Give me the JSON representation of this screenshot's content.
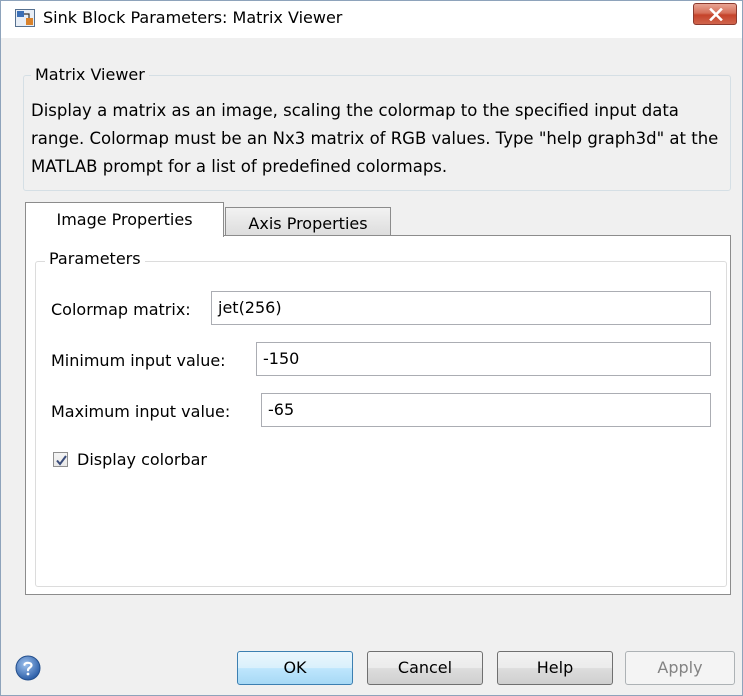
{
  "window": {
    "title": "Sink Block Parameters: Matrix Viewer"
  },
  "header_group": {
    "legend": "Matrix Viewer",
    "description": "Display a matrix as an image, scaling the colormap to the specified input data range.  Colormap must be an Nx3 matrix of RGB values.  Type \"help graph3d\" at the MATLAB prompt for a list of predefined colormaps."
  },
  "tabs": [
    {
      "label": "Image Properties",
      "active": true
    },
    {
      "label": "Axis Properties",
      "active": false
    }
  ],
  "parameters": {
    "legend": "Parameters",
    "colormap": {
      "label": "Colormap matrix:",
      "value": "jet(256)"
    },
    "min_input": {
      "label": "Minimum input value:",
      "value": "-150"
    },
    "max_input": {
      "label": "Maximum input value:",
      "value": "-65"
    },
    "display_colorbar": {
      "label": "Display colorbar",
      "checked": true
    }
  },
  "buttons": {
    "ok": "OK",
    "cancel": "Cancel",
    "help": "Help",
    "apply": "Apply"
  },
  "icons": {
    "app": "simulink-block-icon",
    "close": "close-icon",
    "help": "help-question-icon",
    "check": "checkmark-icon"
  },
  "colors": {
    "close_button": "#c5432a",
    "default_button": "#bee6fd",
    "window_bg": "#f0f0f0"
  }
}
